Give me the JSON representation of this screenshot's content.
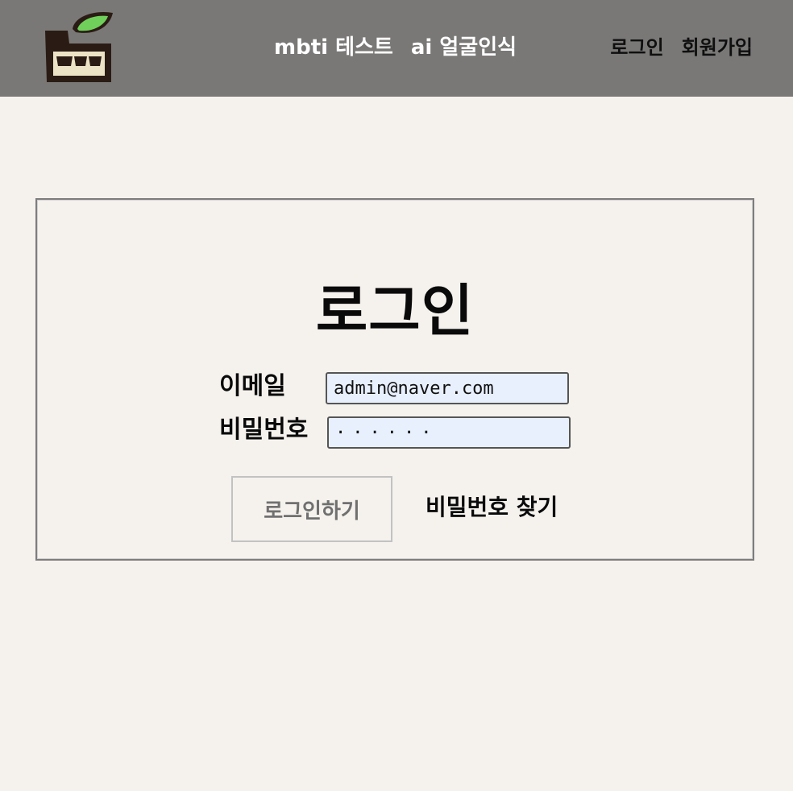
{
  "header": {
    "nav": [
      "mbti 테스트",
      "ai 얼굴인식"
    ],
    "auth": [
      "로그인",
      "회원가입"
    ]
  },
  "login": {
    "title": "로그인",
    "email_label": "이메일",
    "email_value": "admin@naver.com",
    "password_label": "비밀번호",
    "password_value": "······",
    "submit_label": "로그인하기",
    "find_password_label": "비밀번호 찾기"
  },
  "colors": {
    "header_bg": "#7a7877",
    "page_bg": "#f5f2ee",
    "input_bg": "#e8f0fd"
  },
  "icons": {
    "logo": "leaf-basket-logo-icon"
  }
}
